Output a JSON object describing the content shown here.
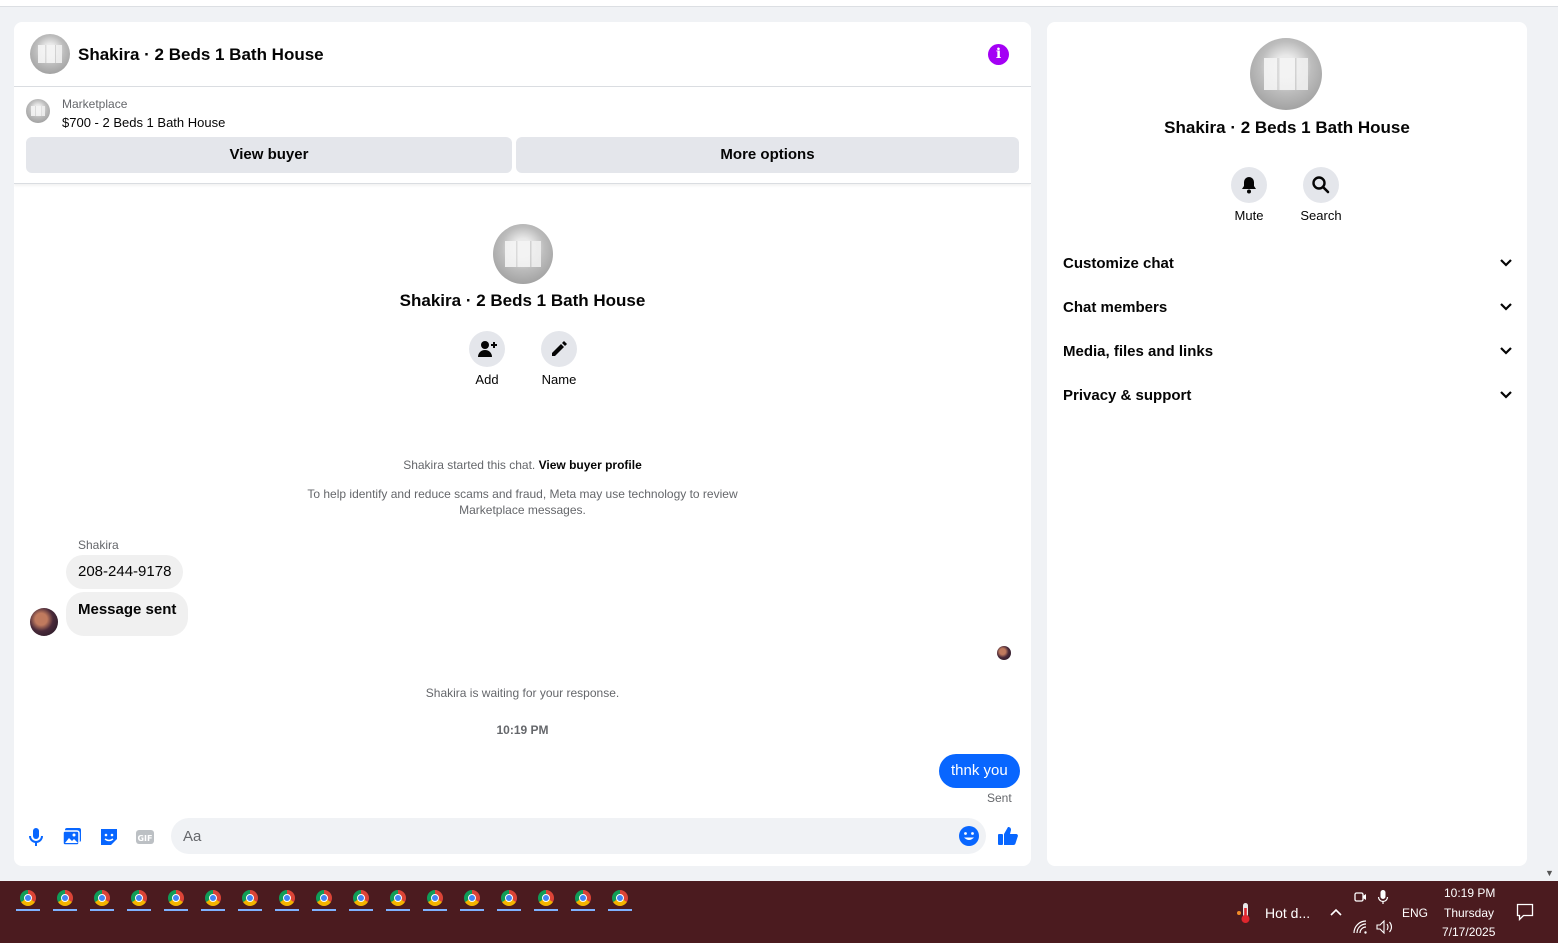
{
  "chat": {
    "title": "Shakira · 2 Beds 1 Bath House",
    "marketplace_label": "Marketplace",
    "listing": "$700 - 2 Beds 1 Bath House",
    "view_buyer": "View buyer",
    "more_options": "More options",
    "center_name": "Shakira · 2 Beds 1 Bath House",
    "add_label": "Add",
    "name_label": "Name",
    "started_text": "Shakira started this chat.",
    "view_profile_link": "View buyer profile",
    "scam_notice_line1": "To help identify and reduce scams and fraud, Meta may use technology to review",
    "scam_notice_line2": "Marketplace messages.",
    "sender_name": "Shakira",
    "messages_in": [
      "208-244-9178",
      "Message sent"
    ],
    "waiting_text": "Shakira is waiting for your response.",
    "timestamp": "10:19 PM",
    "message_out": "thnk you",
    "sent_status": "Sent",
    "input_placeholder": "Aa"
  },
  "info_panel": {
    "name": "Shakira · 2 Beds 1 Bath House",
    "mute_label": "Mute",
    "search_label": "Search",
    "sections": [
      "Customize chat",
      "Chat members",
      "Media, files and links",
      "Privacy & support"
    ]
  },
  "taskbar": {
    "weather": "Hot d...",
    "language": "ENG",
    "time": "10:19 PM",
    "day": "Thursday",
    "date": "7/17/2025"
  },
  "colors": {
    "accent": "#0866ff",
    "info": "#a400f5",
    "taskbar": "#4b1b1f"
  }
}
